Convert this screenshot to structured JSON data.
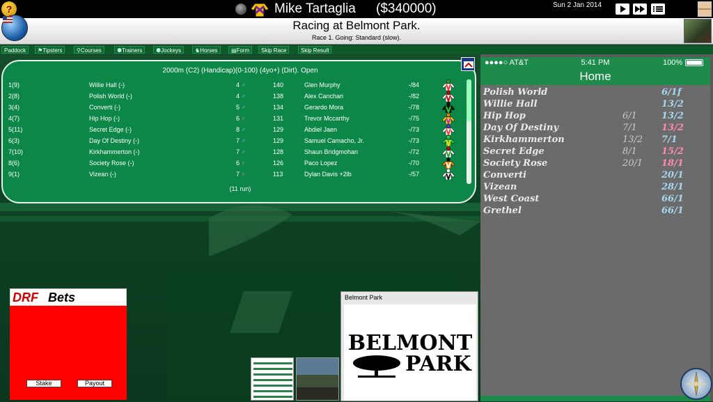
{
  "topbar": {
    "help_label": "?",
    "manager_name": "Mike Tartaglia",
    "cash": "($340000)",
    "date": "Sun 2 Jan 2014"
  },
  "title": {
    "heading": "Racing at Belmont Park.",
    "subtitle": "Race 1. Going: Standard (slow)."
  },
  "nav": [
    {
      "icon": "",
      "label": "Paddock"
    },
    {
      "icon": "⚑",
      "label": "Tipsters"
    },
    {
      "icon": "⚲",
      "label": "Courses"
    },
    {
      "icon": "⚉",
      "label": "Trainers"
    },
    {
      "icon": "⚉",
      "label": "Jockeys"
    },
    {
      "icon": "♞",
      "label": "Horses"
    },
    {
      "icon": "▤",
      "label": "Form"
    },
    {
      "icon": "",
      "label": "Skip Race"
    },
    {
      "icon": "",
      "label": "Skip Result"
    }
  ],
  "racecard": {
    "header": "2000m (C2) (Handicap)(0-100) (4yo+) (Dirt). Open",
    "footer": "(11 run)",
    "entries": [
      {
        "no": "1(9)",
        "horse": "Willie Hall (-)",
        "age": "4",
        "sex": "♂",
        "weight": "140",
        "jockey": "Glen Murphy",
        "rating": "-/84",
        "silk": [
          "#ffffff",
          "#ff2b2b",
          "#2aa12a"
        ]
      },
      {
        "no": "2(8)",
        "horse": "Polish World (-)",
        "age": "4",
        "sex": "♂",
        "weight": "138",
        "jockey": "Alex Canchari",
        "rating": "-/82",
        "silk": [
          "#ffffff",
          "#d40000",
          "#d40000"
        ]
      },
      {
        "no": "3(4)",
        "horse": "Converti (-)",
        "age": "5",
        "sex": "♂",
        "weight": "134",
        "jockey": "Gerardo Mora",
        "rating": "-/78",
        "silk": [
          "#111111",
          "#2bd12b",
          "#111111"
        ]
      },
      {
        "no": "4(7)",
        "horse": "Hip Hop (-)",
        "age": "6",
        "sex": "♀",
        "weight": "131",
        "jockey": "Trevor Mccarthy",
        "rating": "-/75",
        "silk": [
          "#ffd400",
          "#b02bd1",
          "#ff7b00"
        ]
      },
      {
        "no": "5(11)",
        "horse": "Secret Edge (-)",
        "age": "8",
        "sex": "♂",
        "weight": "129",
        "jockey": "Abdiel Jaen",
        "rating": "-/73",
        "silk": [
          "#ffffff",
          "#ff3b3b",
          "#6b2bd1"
        ]
      },
      {
        "no": "6(3)",
        "horse": "Day Of Destiny (-)",
        "age": "7",
        "sex": "♂",
        "weight": "129",
        "jockey": "Samuel Camacho, Jr.",
        "rating": "-/73",
        "silk": [
          "#2bd14a",
          "#ffd400",
          "#2bd14a"
        ]
      },
      {
        "no": "7(10)",
        "horse": "Kirkhammerton (-)",
        "age": "7",
        "sex": "♂",
        "weight": "128",
        "jockey": "Shaun Bridgmohan",
        "rating": "-/72",
        "silk": [
          "#ffffff",
          "#2aa12a",
          "#d40000"
        ]
      },
      {
        "no": "8(6)",
        "horse": "Society Rose (-)",
        "age": "6",
        "sex": "♀",
        "weight": "126",
        "jockey": "Paco Lopez",
        "rating": "-/70",
        "silk": [
          "#ff8a00",
          "#ffffff",
          "#111111"
        ]
      },
      {
        "no": "9(1)",
        "horse": "Vizean (-)",
        "age": "7",
        "sex": "♀",
        "weight": "113",
        "jockey": "Dylan Davis +2lb",
        "rating": "-/57",
        "silk": [
          "#ffffff",
          "#111111",
          "#ffffff"
        ]
      }
    ]
  },
  "phone": {
    "carrier": "●●●●○ AT&T",
    "time": "5:41 PM",
    "battery": "100%",
    "nav_title": "Home",
    "odds": [
      {
        "name": "Polish World",
        "prev": "",
        "odds": "6/1f",
        "color": "#a6d8ef"
      },
      {
        "name": "Willie Hall",
        "prev": "",
        "odds": "13/2",
        "color": "#a6d8ef"
      },
      {
        "name": "Hip Hop",
        "prev": "6/1",
        "odds": "13/2",
        "color": "#a6d8ef"
      },
      {
        "name": "Day Of Destiny",
        "prev": "7/1",
        "odds": "13/2",
        "color": "#ff8ab8"
      },
      {
        "name": "Kirkhammerton",
        "prev": "13/2",
        "odds": "7/1",
        "color": "#a6d8ef"
      },
      {
        "name": "Secret Edge",
        "prev": "8/1",
        "odds": "15/2",
        "color": "#ff8ab8"
      },
      {
        "name": "Society Rose",
        "prev": "20/1",
        "odds": "18/1",
        "color": "#ff8ab8"
      },
      {
        "name": "Converti",
        "prev": "",
        "odds": "20/1",
        "color": "#a6d8ef"
      },
      {
        "name": "Vizean",
        "prev": "",
        "odds": "28/1",
        "color": "#a6d8ef"
      },
      {
        "name": "West Coast",
        "prev": "",
        "odds": "66/1",
        "color": "#a6d8ef"
      },
      {
        "name": "Grethel",
        "prev": "",
        "odds": "66/1",
        "color": "#a6d8ef"
      }
    ]
  },
  "drf": {
    "logo_drf": "DRF",
    "logo_bets": "Bets",
    "stake_label": "Stake",
    "payout_label": "Payout"
  },
  "course": {
    "label": "Belmont Park",
    "logo_line1": "BELMONT",
    "logo_line2": "PARK"
  }
}
